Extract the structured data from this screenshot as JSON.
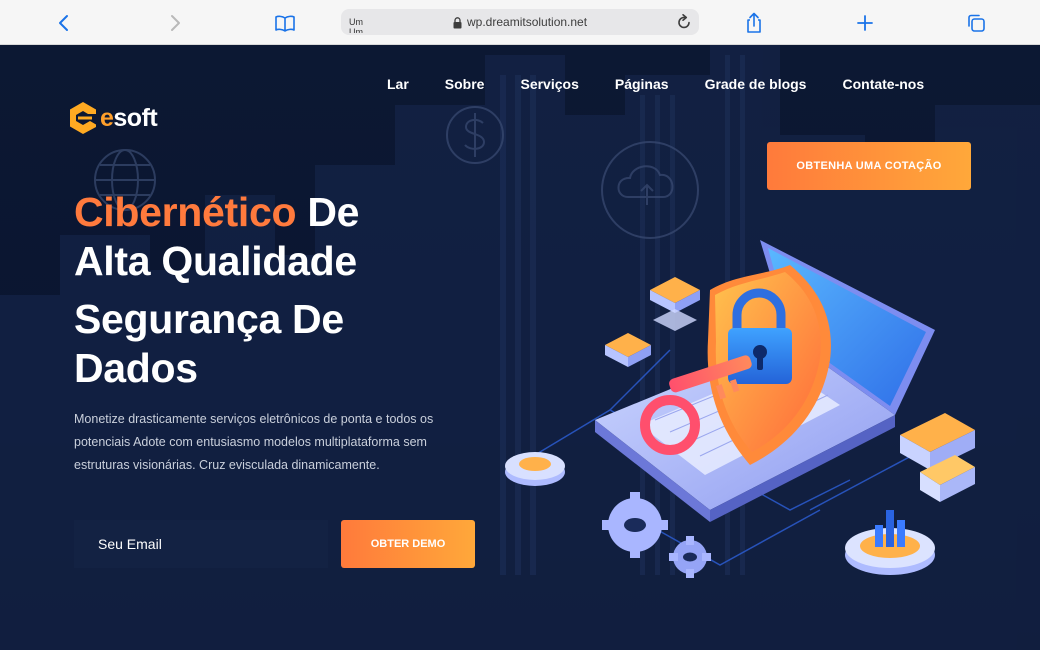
{
  "browser": {
    "tab_title": "Um Um",
    "url": "wp.dreamitsolution.net"
  },
  "brand": {
    "logo_letter": "e",
    "logo_rest": "soft",
    "accent_color": "#ff7a3d"
  },
  "nav": {
    "items": [
      {
        "label": "Lar"
      },
      {
        "label": "Sobre"
      },
      {
        "label": "Serviços"
      },
      {
        "label": "Páginas"
      },
      {
        "label": "Grade de blogs"
      },
      {
        "label": "Contate-nos"
      }
    ]
  },
  "cta": {
    "quote_label": "OBTENHA UMA COTAÇÃO",
    "demo_label": "OBTER DEMO"
  },
  "hero": {
    "line1_accent": "Cibernético",
    "line1_rest": " De",
    "line2": "Alta Qualidade",
    "line3": "Segurança De",
    "line4": "Dados",
    "description": "Monetize drasticamente serviços eletrônicos de ponta e todos os potenciais Adote com entusiasmo modelos multiplataforma sem estruturas visionárias. Cruz evisculada dinamicamente."
  },
  "form": {
    "email_placeholder": "Seu Email"
  },
  "icons": {
    "toolbar": [
      "back-icon",
      "forward-icon",
      "bookmarks-icon",
      "lock-icon",
      "reload-icon",
      "share-icon",
      "new-tab-icon",
      "tabs-icon"
    ],
    "illustration": [
      "laptop",
      "shield-lock",
      "key",
      "gears",
      "server-stack",
      "bar-chart"
    ]
  }
}
